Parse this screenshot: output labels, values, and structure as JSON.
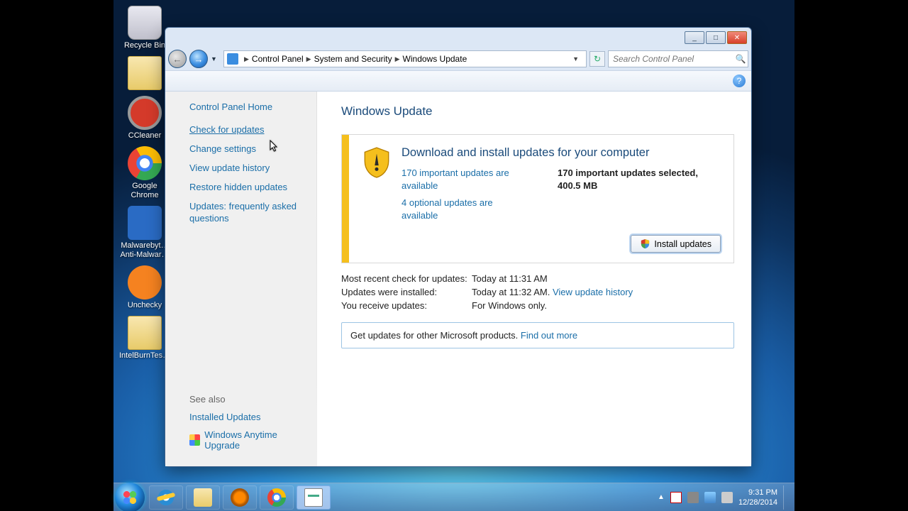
{
  "desktop_icons": [
    {
      "label": "Recycle Bin"
    },
    {
      "label": ""
    },
    {
      "label": "CCleaner"
    },
    {
      "label": "Google Chrome"
    },
    {
      "label": "Malwarebyt… Anti-Malwar…"
    },
    {
      "label": "Unchecky"
    },
    {
      "label": "IntelBurnTes…"
    }
  ],
  "taskbar": {
    "tray_time": "9:31 PM",
    "tray_date": "12/28/2014"
  },
  "window": {
    "titlebar": {
      "min": "_",
      "max": "□",
      "close": "✕"
    },
    "breadcrumbs": [
      "Control Panel",
      "System and Security",
      "Windows Update"
    ],
    "search_placeholder": "Search Control Panel"
  },
  "sidebar": {
    "home": "Control Panel Home",
    "links": [
      "Check for updates",
      "Change settings",
      "View update history",
      "Restore hidden updates",
      "Updates: frequently asked questions"
    ],
    "see_also_heading": "See also",
    "see_also": [
      "Installed Updates",
      "Windows Anytime Upgrade"
    ]
  },
  "content": {
    "page_title": "Windows Update",
    "panel_heading": "Download and install updates for your computer",
    "important_link": "170 important updates are available",
    "optional_link": "4 optional updates are available",
    "selected_line1": "170 important updates selected,",
    "selected_line2": "400.5 MB",
    "install_button": "Install updates",
    "meta": [
      {
        "label": "Most recent check for updates:",
        "value": "Today at 11:31 AM"
      },
      {
        "label": "Updates were installed:",
        "value": "Today at 11:32 AM.",
        "link": "View update history"
      },
      {
        "label": "You receive updates:",
        "value": "For Windows only."
      }
    ],
    "other_text": "Get updates for other Microsoft products. ",
    "other_link": "Find out more"
  }
}
